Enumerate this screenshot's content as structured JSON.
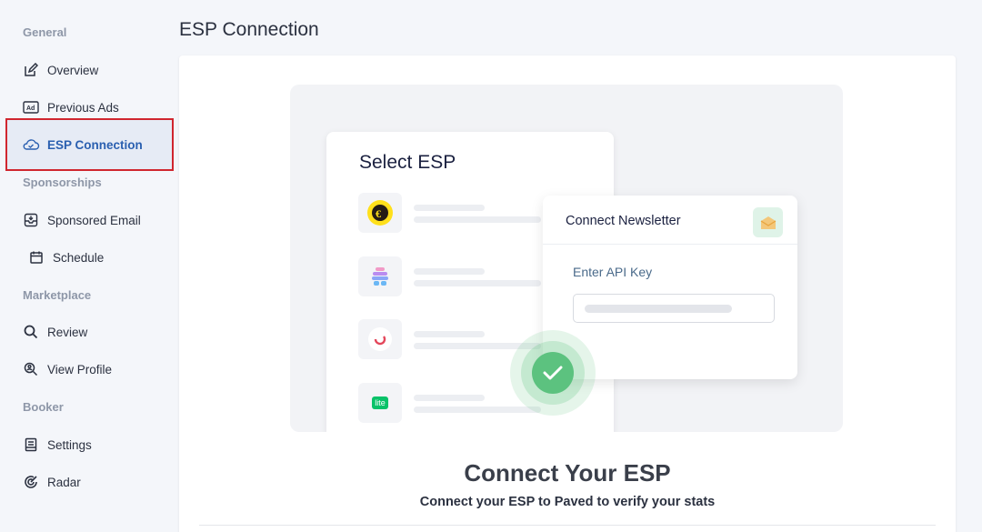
{
  "sidebar": {
    "sections": [
      "General",
      "Sponsorships",
      "Marketplace",
      "Booker"
    ],
    "items": [
      {
        "label": "Overview",
        "icon": "edit-icon"
      },
      {
        "label": "Previous Ads",
        "icon": "ad-icon"
      },
      {
        "label": "ESP Connection",
        "icon": "cloud-icon",
        "active": true
      },
      {
        "label": "Sponsored Email",
        "icon": "sponsored-email-icon"
      },
      {
        "label": "Schedule",
        "icon": "calendar-icon"
      },
      {
        "label": "Review",
        "icon": "search-icon"
      },
      {
        "label": "View Profile",
        "icon": "view-profile-icon"
      },
      {
        "label": "Settings",
        "icon": "settings-icon"
      },
      {
        "label": "Radar",
        "icon": "radar-icon"
      }
    ]
  },
  "header": {
    "title": "ESP Connection"
  },
  "illustration": {
    "select_title": "Select ESP",
    "connect_title": "Connect Newsletter",
    "api_label": "Enter API Key",
    "lite_text": "lite"
  },
  "main": {
    "heading": "Connect Your ESP",
    "subheading": "Connect your ESP to Paved to verify your stats"
  },
  "colors": {
    "accent": "#2a5fb0",
    "highlight_outline": "#d0262f",
    "success": "#5cc27f"
  }
}
